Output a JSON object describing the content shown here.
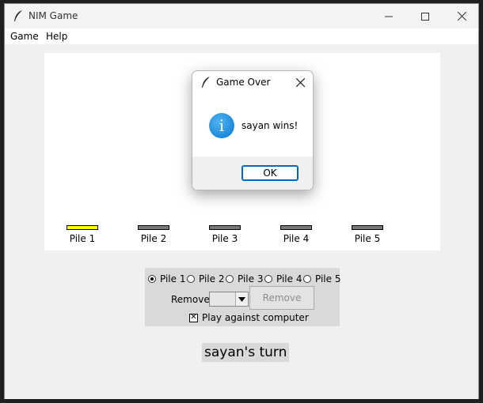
{
  "window": {
    "title": "NIM Game"
  },
  "menu": [
    {
      "label": "Game"
    },
    {
      "label": "Help"
    }
  ],
  "piles": [
    {
      "label": "Pile 1",
      "active": true
    },
    {
      "label": "Pile 2",
      "active": false
    },
    {
      "label": "Pile 3",
      "active": false
    },
    {
      "label": "Pile 4",
      "active": false
    },
    {
      "label": "Pile 5",
      "active": false
    }
  ],
  "dialog": {
    "title": "Game Over",
    "message": "sayan wins!",
    "ok_label": "OK",
    "icon": "info-icon"
  },
  "controls": {
    "pile_options": [
      {
        "label": "Pile 1",
        "selected": true
      },
      {
        "label": "Pile 2",
        "selected": false
      },
      {
        "label": "Pile 3",
        "selected": false
      },
      {
        "label": "Pile 4",
        "selected": false
      },
      {
        "label": "Pile 5",
        "selected": false
      }
    ],
    "remove_label": "Remove:",
    "remove_value": "",
    "remove_button": "Remove",
    "play_computer_label": "Play against computer",
    "play_computer_checked": true
  },
  "status": {
    "text": "sayan's turn"
  },
  "colors": {
    "active_pile": "#ffff00",
    "inactive_pile": "#777777",
    "accent": "#0067c0"
  }
}
